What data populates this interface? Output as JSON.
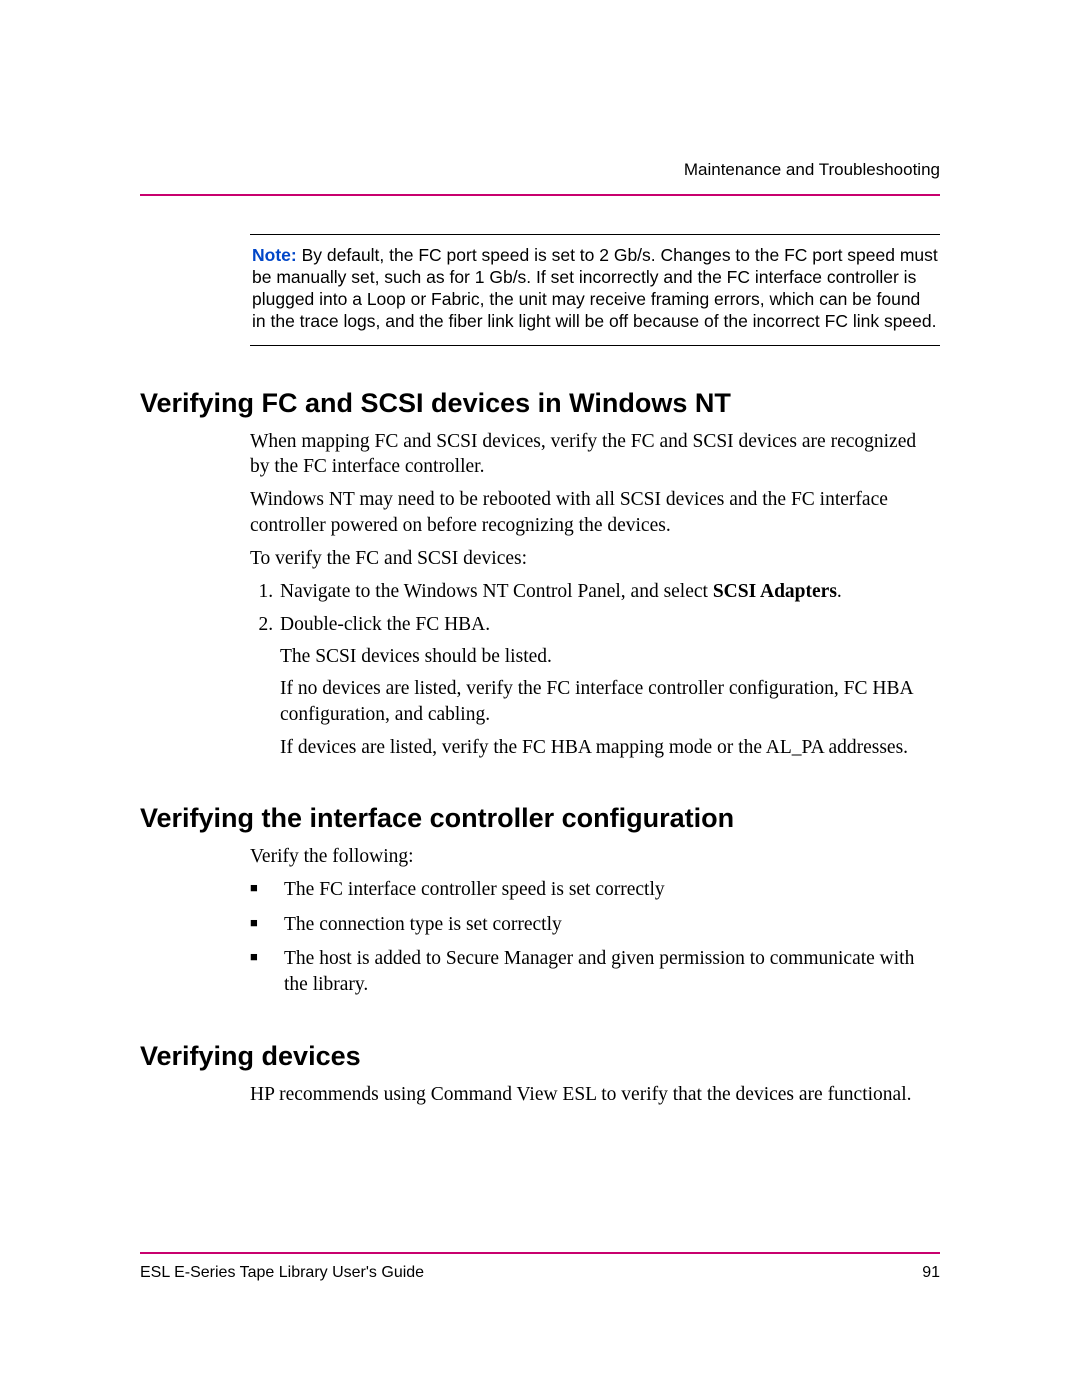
{
  "header": {
    "section": "Maintenance and Troubleshooting"
  },
  "note": {
    "label": "Note:",
    "text": "By default, the FC port speed is set to 2 Gb/s. Changes to the FC port speed must be manually set, such as for 1 Gb/s. If set incorrectly and the FC interface controller is plugged into a Loop or Fabric, the unit may receive framing errors, which can be found in the trace logs, and the fiber link light will be off because of the incorrect FC link speed."
  },
  "section1": {
    "heading": "Verifying FC and SCSI devices in Windows NT",
    "p1": "When mapping FC and SCSI devices, verify the FC and SCSI devices are recognized by the FC interface controller.",
    "p2": "Windows NT may need to be rebooted with all SCSI devices and the FC interface controller powered on before recognizing the devices.",
    "p3": "To verify the FC and SCSI devices:",
    "step1_pre": "Navigate to the Windows NT Control Panel, and select ",
    "step1_bold": "SCSI Adapters",
    "step1_post": ".",
    "step2": "Double-click the FC HBA.",
    "step2_sub1": "The SCSI devices should be listed.",
    "step2_sub2": "If no devices are listed, verify the FC interface controller configuration, FC HBA configuration, and cabling.",
    "step2_sub3": "If devices are listed, verify the FC HBA mapping mode or the AL_PA addresses."
  },
  "section2": {
    "heading": "Verifying the interface controller configuration",
    "p1": "Verify the following:",
    "b1": "The FC interface controller speed is set correctly",
    "b2": "The connection type is set correctly",
    "b3": "The host is added to Secure Manager and given permission to communicate with the library."
  },
  "section3": {
    "heading": "Verifying devices",
    "p1": "HP recommends using Command View ESL to verify that the devices are functional."
  },
  "footer": {
    "doc": "ESL E-Series Tape Library User's Guide",
    "page": "91"
  }
}
